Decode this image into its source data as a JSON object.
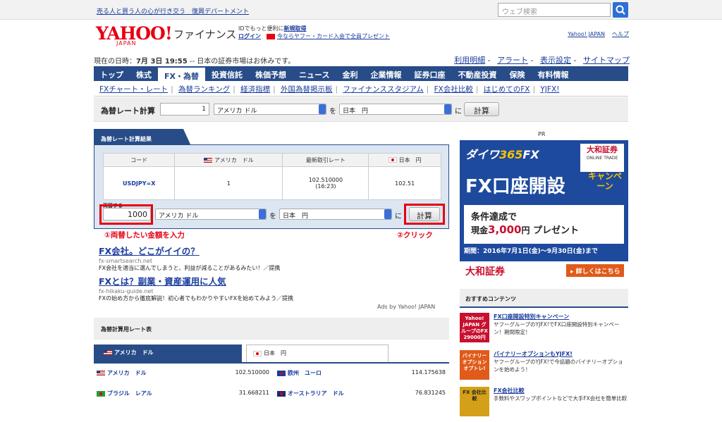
{
  "topbar": {
    "link": "売る人と買う人の心が行き交う　復興デパートメント",
    "search_placeholder": "ウェブ検索"
  },
  "header": {
    "logo": "YAHOO!",
    "logo_sub": "JAPAN",
    "section": "ファイナンス",
    "id_text": "IDでもっと便利に",
    "register": "新規取得",
    "login": "ログイン",
    "card_promo": "今ならヤフー・カード入会で全員プレゼント",
    "yahoo_japan": "Yahoo! JAPAN",
    "help": "ヘルプ"
  },
  "status": {
    "prefix": "現在の日時：",
    "date": "7月 3日 19:55",
    "suffix": " -- 日本の証券市場はお休みです。"
  },
  "sublinks": [
    "利用明細",
    "アラート",
    "表示設定",
    "サイトマップ"
  ],
  "nav": [
    "トップ",
    "株式",
    "FX・為替",
    "投資信託",
    "株価予想",
    "ニュース",
    "金利",
    "企業情報",
    "証券口座",
    "不動産投資",
    "保険",
    "有料情報"
  ],
  "subnav": [
    "FXチャート・レート",
    "為替ランキング",
    "経済指標",
    "外国為替掲示板",
    "ファイナンススタジアム",
    "FX会社比較",
    "はじめてのFX",
    "YJFX!"
  ],
  "calc": {
    "label": "為替レート計算",
    "amount": "1",
    "from": "アメリカ ドル",
    "wo": "を",
    "to": "日本　円",
    "ni": "に",
    "button": "計算"
  },
  "result": {
    "tab": "為替レート計算結果",
    "headers": [
      "コード",
      "アメリカ　ドル",
      "最新取引レート",
      "日本　円"
    ],
    "row": {
      "code": "USDJPY=X",
      "base": "1",
      "rate": "102.510000",
      "time": "(16:23)",
      "converted": "102.51"
    },
    "exchange_label": "両替する",
    "amount": "1000",
    "from": "アメリカ ドル",
    "wo": "を",
    "to": "日本　円",
    "ni": "に",
    "button": "計算"
  },
  "annotations": {
    "step1": "①両替したい金額を入力",
    "step2": "②クリック"
  },
  "ads": [
    {
      "title": "FX会社。どこがイイの？",
      "url": "fx-smartsearch.net",
      "desc": "FX会社を適当に選んでしまうと、利益が減ることがあるみたい！／提携"
    },
    {
      "title": "FXとは？副業・資産運用に人気",
      "url": "fx-hikaku-guide.net",
      "desc": "FXの始め方から徹底解説！初心者でもわかりやすいFXを始めてみよう／提携"
    }
  ],
  "ads_by": "Ads by Yahoo! JAPAN",
  "rate_table": {
    "title": "為替計算用レート表",
    "tabs": [
      "アメリカ　ドル",
      "日本　円"
    ],
    "rows": [
      {
        "name": "アメリカ　ドル",
        "value": "102.510000"
      },
      {
        "name": "欧州　ユーロ",
        "value": "114.175638"
      },
      {
        "name": "ブラジル　レアル",
        "value": "31.668211"
      },
      {
        "name": "オーストラリア　ドル",
        "value": "76.831245"
      }
    ]
  },
  "pr": "PR",
  "banner": {
    "brand": "ダイワ",
    "brand_num": "365",
    "brand_fx": "FX",
    "company_logo": "大和証券",
    "company_logo_sub": "ONLINE TRADE",
    "headline": "FX口座開設",
    "campaign": "キャンペーン",
    "cond": "条件達成で",
    "cash_prefix": "現金",
    "cash_amount": "3,000",
    "cash_unit": "円",
    "present": " プレゼント",
    "period": "期間：2016年7月1日(金)～9月30日(金)まで",
    "company": "大和証券",
    "more": "▸ 詳しくはこちら"
  },
  "recommend": {
    "title": "おすすめコンテンツ",
    "items": [
      {
        "thumb": "Yahoo! JAPAN グループのFX 29000円",
        "title": "FX口座開設特別キャンペーン",
        "desc": "ヤフーグループのYJFX!でFX口座開設特別キャンペーン！期間限定！"
      },
      {
        "thumb": "バイナリーオプション オプトレ!",
        "title": "バイナリーオプションもYJFX!",
        "desc": "ヤフーグループのYJFX!で今話題のバイナリーオプションを始めよう！"
      },
      {
        "thumb": "FX 会社比較",
        "title": "FX会社比較",
        "desc": "手数料やスワップポイントなどで大手FX会社を簡単比較"
      }
    ]
  }
}
